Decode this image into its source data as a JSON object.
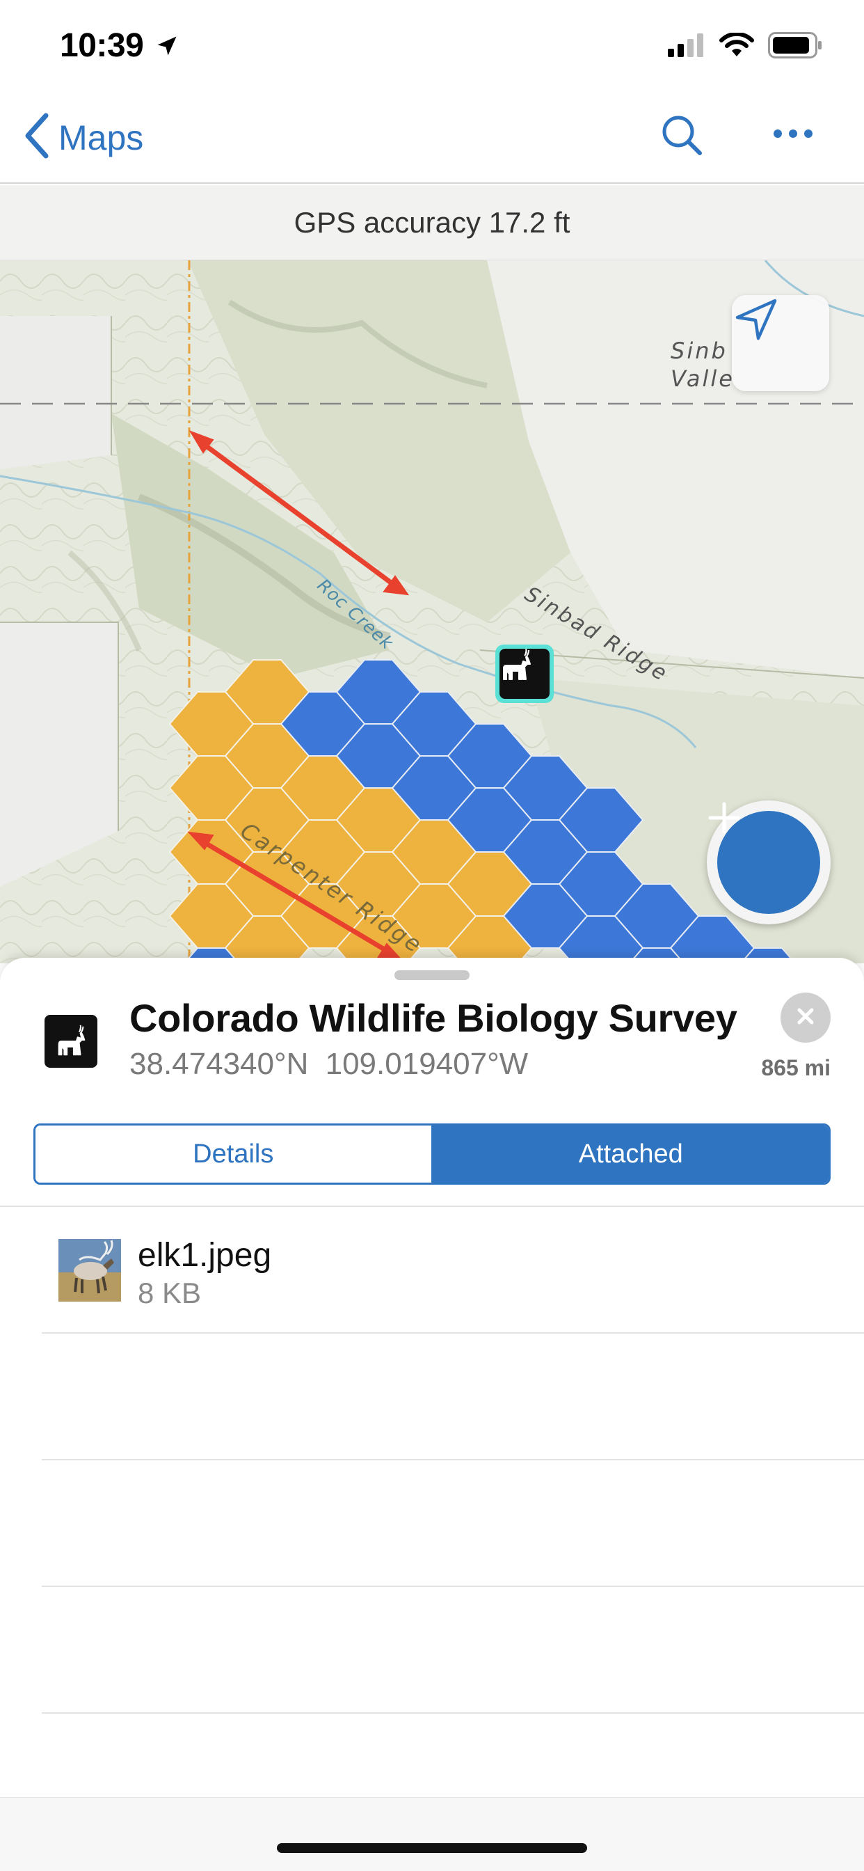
{
  "status_bar": {
    "time": "10:39",
    "icons": [
      "location-arrow-icon",
      "cellular-signal-icon",
      "wifi-icon",
      "battery-icon"
    ]
  },
  "nav": {
    "back_label": "Maps",
    "icons": [
      "chevron-left-icon",
      "search-icon",
      "more-icon"
    ]
  },
  "gps": {
    "text": "GPS accuracy 17.2 ft"
  },
  "map": {
    "labels": {
      "valley": "Sinb\nValle",
      "sinbad_ridge": "Sinbad Ridge",
      "roc_creek": "Roc Creek",
      "carpenter_ridge": "Carpenter Ridge"
    },
    "colors": {
      "hex_orange": "#eeb23f",
      "hex_blue": "#3d78d8",
      "arrow_red": "#e8412e",
      "accent": "#2f74c0"
    }
  },
  "feature": {
    "title": "Colorado Wildlife Biology Survey",
    "latitude": "38.474340°N",
    "longitude": "109.019407°W",
    "distance": "865 mi"
  },
  "tabs": {
    "details": "Details",
    "attached": "Attached",
    "selected": "Attached"
  },
  "attachments": [
    {
      "name": "elk1.jpeg",
      "size": "8 KB"
    }
  ]
}
